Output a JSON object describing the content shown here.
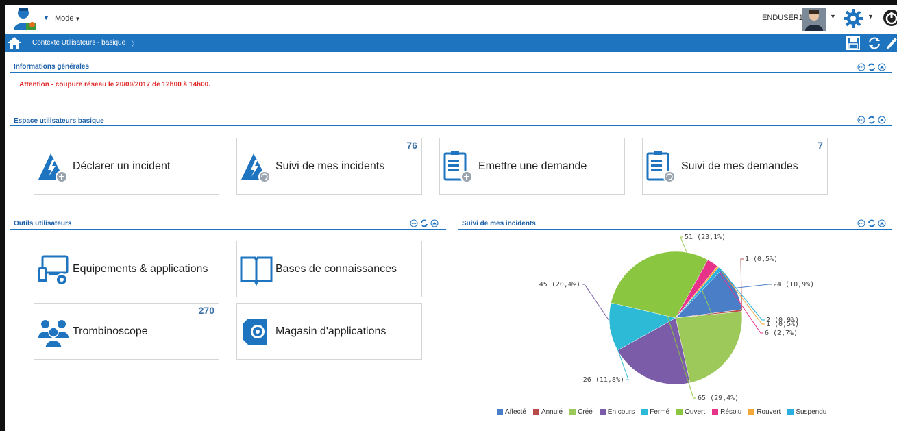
{
  "header": {
    "mode_label": "Mode",
    "username": "ENDUSER1"
  },
  "nav": {
    "breadcrumb": "Contexte Utilisateurs - basique",
    "separator": "〉"
  },
  "sections": {
    "general": {
      "title": "Informations générales",
      "alert": "Attention - coupure réseau le 20/09/2017 de 12h00 à 14h00."
    },
    "space": {
      "title": "Espace utilisateurs basique",
      "tiles": [
        {
          "label": "Déclarer un incident",
          "count": "",
          "icon": "incident-add-icon"
        },
        {
          "label": "Suivi de mes incidents",
          "count": "76",
          "icon": "incident-track-icon"
        },
        {
          "label": "Emettre une demande",
          "count": "",
          "icon": "request-add-icon"
        },
        {
          "label": "Suivi de mes demandes",
          "count": "7",
          "icon": "request-track-icon"
        }
      ]
    },
    "tools": {
      "title": "Outils utilisateurs",
      "tiles": [
        {
          "label": "Equipements & applications",
          "count": "",
          "icon": "devices-icon"
        },
        {
          "label": "Bases de connaissances",
          "count": "",
          "icon": "book-icon"
        },
        {
          "label": "Trombinoscope",
          "count": "270",
          "icon": "people-icon"
        },
        {
          "label": "Magasin d'applications",
          "count": "",
          "icon": "app-store-icon"
        }
      ]
    },
    "incidents": {
      "title": "Suivi de mes incidents"
    }
  },
  "colors": {
    "primary": "#1f74c0",
    "title": "#1a5fa8",
    "alert": "#e02a2a"
  },
  "chart_data": {
    "type": "pie",
    "title": "",
    "series": [
      {
        "name": "Affecté",
        "value": 24,
        "label": "24 (10,9%)",
        "color": "#4a7fc8"
      },
      {
        "name": "Annulé",
        "value": 1,
        "label": "1 (0,5%)",
        "color": "#b84a4a"
      },
      {
        "name": "Créé",
        "value": 51,
        "label": "51 (23,1%)",
        "color": "#9cc95a"
      },
      {
        "name": "En cours",
        "value": 45,
        "label": "45 (20,4%)",
        "color": "#7a5ca8"
      },
      {
        "name": "Fermé",
        "value": 26,
        "label": "26 (11,8%)",
        "color": "#2cbad6"
      },
      {
        "name": "Ouvert",
        "value": 65,
        "label": "65 (29,4%)",
        "color": "#8bc640"
      },
      {
        "name": "Résolu",
        "value": 6,
        "label": "6 (2,7%)",
        "color": "#e8338a"
      },
      {
        "name": "Rouvert",
        "value": 1,
        "label": "1 (0,5%)",
        "color": "#f2a93a"
      },
      {
        "name": "Suspendu",
        "value": 2,
        "label": "2 (0,9%)",
        "color": "#2ab0e0"
      }
    ],
    "legend": "bottom"
  }
}
